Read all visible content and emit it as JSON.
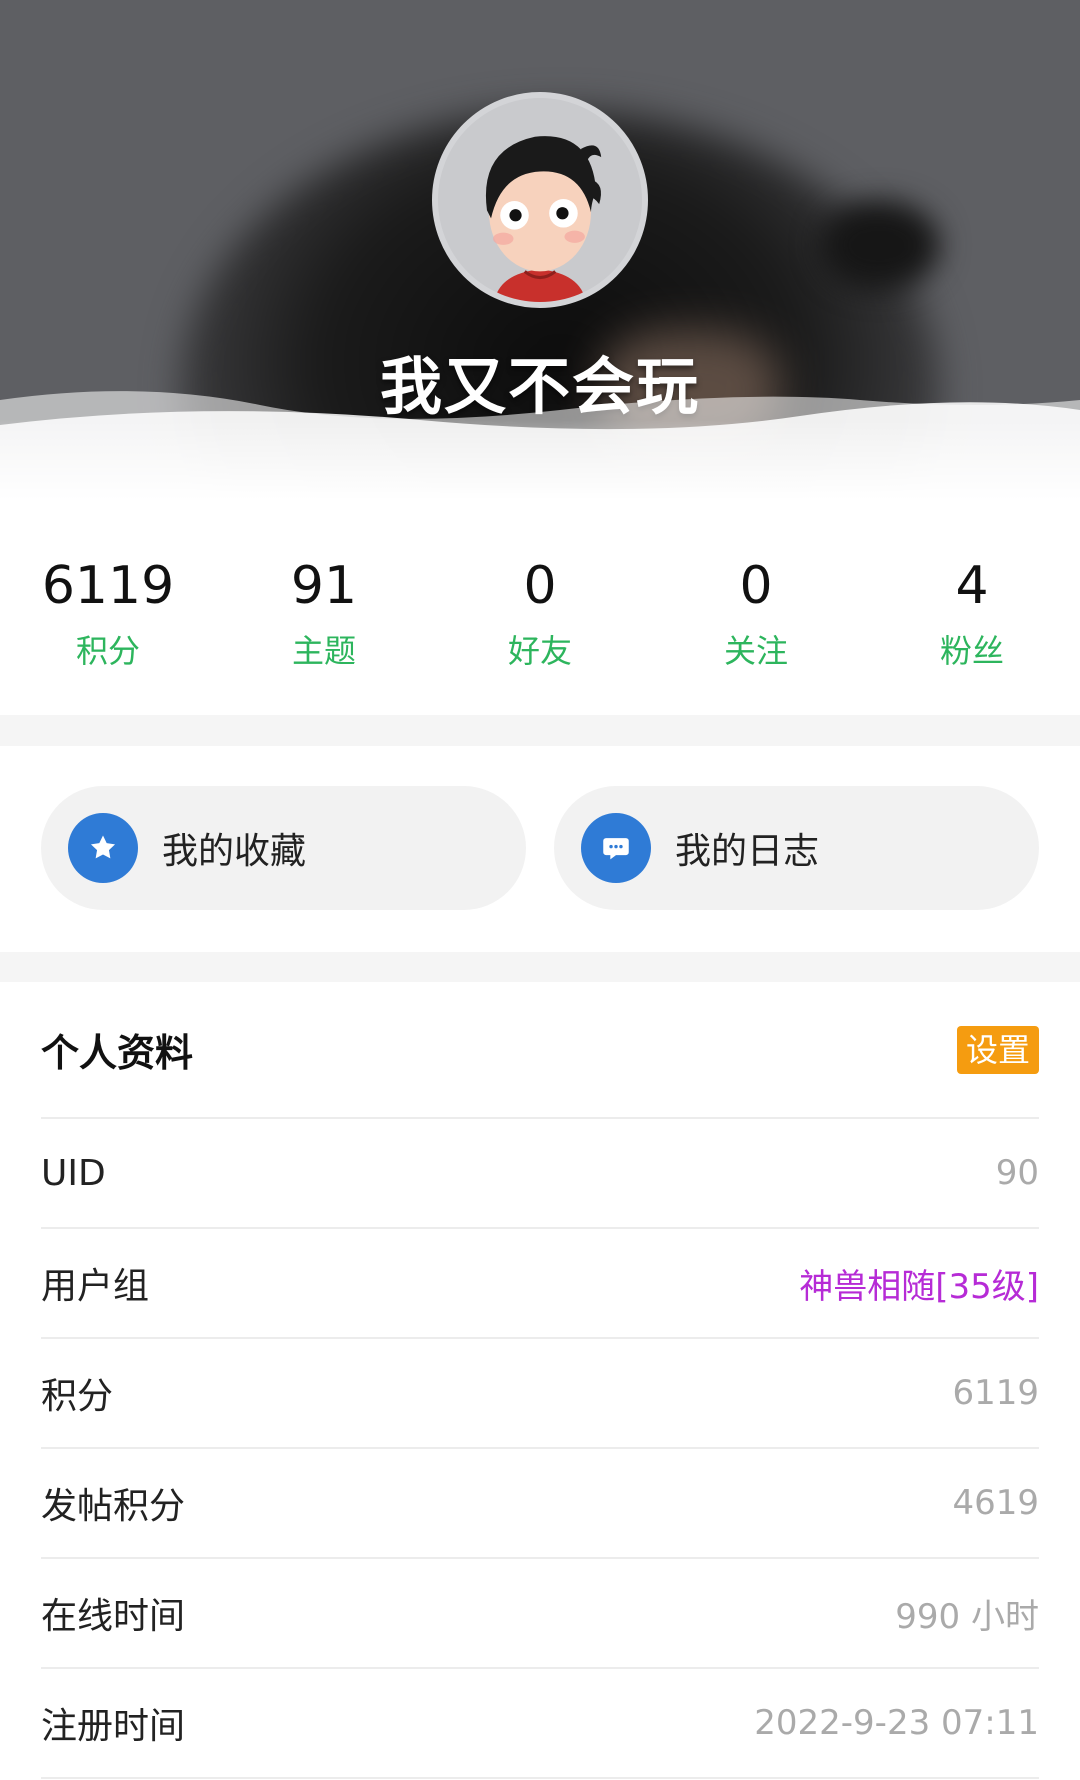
{
  "header": {
    "username": "我又不会玩"
  },
  "stats": [
    {
      "value": "6119",
      "label": "积分"
    },
    {
      "value": "91",
      "label": "主题"
    },
    {
      "value": "0",
      "label": "好友"
    },
    {
      "value": "0",
      "label": "关注"
    },
    {
      "value": "4",
      "label": "粉丝"
    }
  ],
  "quick_links": {
    "favorites": {
      "label": "我的收藏",
      "icon": "star-icon"
    },
    "diary": {
      "label": "我的日志",
      "icon": "chat-bubble-icon"
    }
  },
  "profile": {
    "title": "个人资料",
    "settings_label": "设置",
    "rows": [
      {
        "key": "UID",
        "value": "90"
      },
      {
        "key": "用户组",
        "value": "神兽相随[35级]"
      },
      {
        "key": "积分",
        "value": "6119"
      },
      {
        "key": "发帖积分",
        "value": "4619"
      },
      {
        "key": "在线时间",
        "value": "990 小时"
      },
      {
        "key": "注册时间",
        "value": "2022-9-23 07:11"
      }
    ]
  },
  "colors": {
    "accent_green": "#2db55d",
    "link_blue": "#2f7bd6",
    "settings_orange": "#f59c10",
    "usergroup_purple": "#b62bd6"
  }
}
